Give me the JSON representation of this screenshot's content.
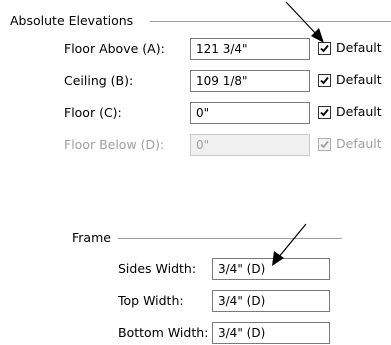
{
  "absolute_elevations": {
    "title": "Absolute Elevations",
    "rows": [
      {
        "label": "Floor Above (A):",
        "value": "121 3/4\"",
        "checkbox_label": "Default",
        "checked": true,
        "enabled": true
      },
      {
        "label": "Ceiling (B):",
        "value": "109 1/8\"",
        "checkbox_label": "Default",
        "checked": true,
        "enabled": true
      },
      {
        "label": "Floor (C):",
        "value": "0\"",
        "checkbox_label": "Default",
        "checked": true,
        "enabled": true
      },
      {
        "label": "Floor Below (D):",
        "value": "0\"",
        "checkbox_label": "Default",
        "checked": true,
        "enabled": false
      }
    ]
  },
  "frame": {
    "title": "Frame",
    "rows": [
      {
        "label": "Sides Width:",
        "value": "3/4\" (D)"
      },
      {
        "label": "Top Width:",
        "value": "3/4\" (D)"
      },
      {
        "label": "Bottom Width:",
        "value": "3/4\" (D)"
      }
    ]
  },
  "colors": {
    "disabled_text": "#a0a0a0",
    "group_line": "#a0a0a0",
    "arrow": "#000000"
  },
  "annotations": {
    "arrow_icon_1": "arrow-pointing-to-default-checkbox",
    "arrow_icon_2": "arrow-pointing-to-sides-width-field"
  }
}
